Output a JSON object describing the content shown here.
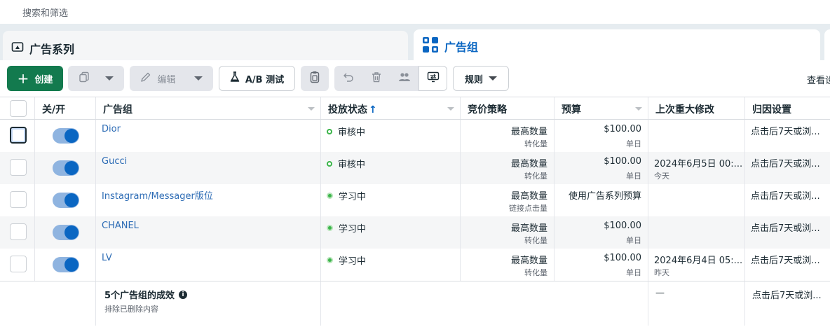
{
  "search": {
    "label": "搜索和筛选"
  },
  "tabs": {
    "campaign": "广告系列",
    "adset": "广告组"
  },
  "toolbar": {
    "create": "创建",
    "edit": "编辑",
    "ab_test": "A/B 测试",
    "rules": "规则",
    "view_more": "查看设"
  },
  "table": {
    "headers": {
      "onoff": "关/开",
      "name": "广告组",
      "status": "投放状态",
      "bid": "竞价策略",
      "budget": "预算",
      "last_edit": "上次重大修改",
      "attribution": "归因设置"
    },
    "rows": [
      {
        "name": "Dior",
        "status": "审核中",
        "bid": "最高数量",
        "bid_sub": "转化量",
        "budget": "$100.00",
        "budget_sub": "单日",
        "last_edit": "",
        "last_edit_sub": "",
        "attribution": "点击后7天或浏..."
      },
      {
        "name": "Gucci",
        "status": "审核中",
        "bid": "最高数量",
        "bid_sub": "转化量",
        "budget": "$100.00",
        "budget_sub": "单日",
        "last_edit": "2024年6月5日 00:...",
        "last_edit_sub": "今天",
        "attribution": "点击后7天或浏..."
      },
      {
        "name": "Instagram/Messager版位",
        "status": "学习中",
        "bid": "最高数量",
        "bid_sub": "链接点击量",
        "budget": "使用广告系列预算",
        "budget_sub": "",
        "last_edit": "",
        "last_edit_sub": "",
        "attribution": "点击后7天或浏..."
      },
      {
        "name": "CHANEL",
        "status": "学习中",
        "bid": "最高数量",
        "bid_sub": "转化量",
        "budget": "$100.00",
        "budget_sub": "单日",
        "last_edit": "",
        "last_edit_sub": "",
        "attribution": "点击后7天或浏..."
      },
      {
        "name": "LV",
        "status": "学习中",
        "bid": "最高数量",
        "bid_sub": "转化量",
        "budget": "$100.00",
        "budget_sub": "单日",
        "last_edit": "2024年6月4日 05:...",
        "last_edit_sub": "昨天",
        "attribution": "点击后7天或浏..."
      }
    ],
    "footer": {
      "title": "5个广告组的成效",
      "subtitle": "排除已删除内容",
      "last_edit": "—",
      "attribution": "点击后7天或浏..."
    }
  },
  "colors": {
    "primary": "#137a4e",
    "link": "#2d6cb5",
    "accent": "#0a66c2",
    "status_green": "#3bb54a"
  }
}
